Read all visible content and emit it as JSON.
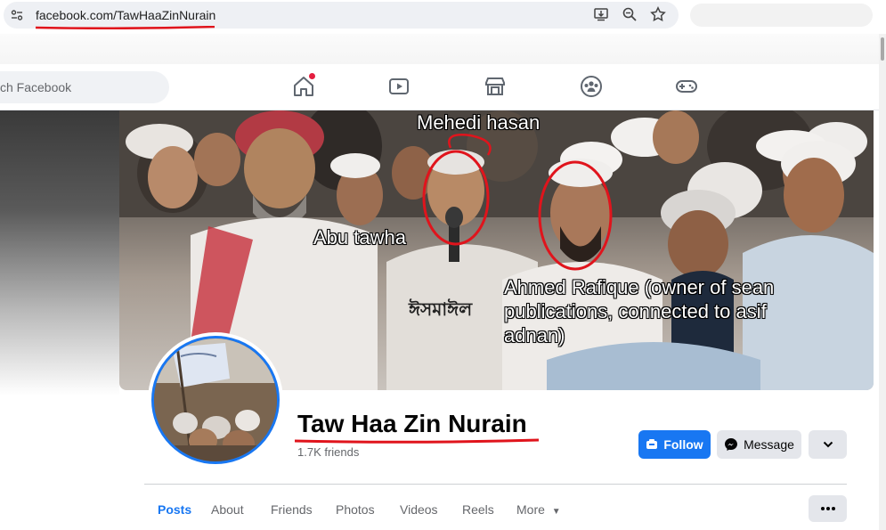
{
  "browser": {
    "url": "facebook.com/TawHaaZinNurain",
    "icons": [
      "site-settings-icon",
      "install-app-icon",
      "zoom-icon",
      "bookmark-star-icon"
    ]
  },
  "facebook_nav": {
    "search_placeholder": "ch Facebook",
    "icons": [
      "home-icon",
      "watch-icon",
      "marketplace-icon",
      "groups-icon",
      "gaming-icon"
    ]
  },
  "cover": {
    "annotations": {
      "mehedi": "Mehedi hasan",
      "abu": "Abu tawha",
      "ahmed_line1": "Ahmed Rafique (owner of sean",
      "ahmed_line2": "publications, connected to asif",
      "ahmed_line3": "adnan)"
    },
    "sign_text": "ঈসমাঈল"
  },
  "profile": {
    "name": "Taw Haa Zin Nurain",
    "friends": "1.7K friends"
  },
  "actions": {
    "follow": "Follow",
    "message": "Message"
  },
  "tabs": [
    "Posts",
    "About",
    "Friends",
    "Photos",
    "Videos",
    "Reels",
    "More"
  ],
  "colors": {
    "fb_blue": "#1877f2",
    "annotation_red": "#e0141c"
  }
}
